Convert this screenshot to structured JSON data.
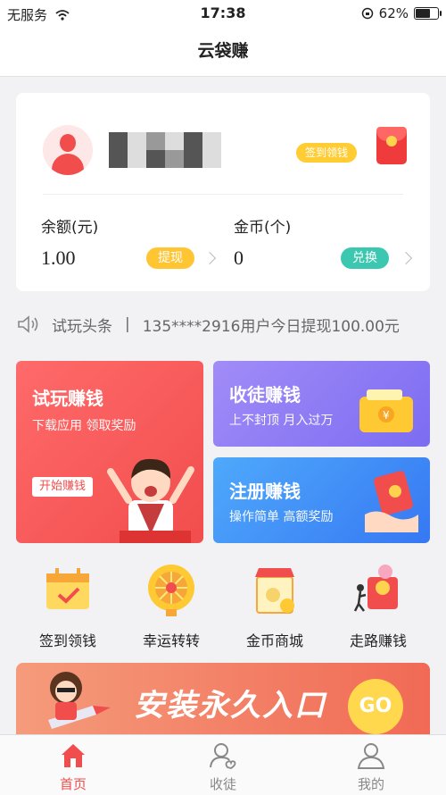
{
  "status_bar": {
    "carrier": "无服务",
    "time": "17:38",
    "battery": "62%"
  },
  "nav": {
    "title": "云袋赚"
  },
  "account": {
    "sign_label": "签到领钱",
    "balance_label": "余额(元)",
    "balance_value": "1.00",
    "withdraw_label": "提现",
    "coins_label": "金币(个)",
    "coins_value": "0",
    "exchange_label": "兑换"
  },
  "ticker": {
    "title": "试玩头条",
    "separator": "|",
    "message": "135****2916用户今日提现100.00元"
  },
  "tiles": {
    "trial": {
      "title": "试玩赚钱",
      "subtitle": "下载应用 领取奖励",
      "button": "开始赚钱"
    },
    "recruit": {
      "title": "收徒赚钱",
      "subtitle": "上不封顶 月入过万"
    },
    "register": {
      "title": "注册赚钱",
      "subtitle": "操作简单 高额奖励"
    }
  },
  "shortcuts": [
    {
      "label": "签到领钱",
      "icon": "calendar-icon"
    },
    {
      "label": "幸运转转",
      "icon": "lucky-wheel-icon"
    },
    {
      "label": "金币商城",
      "icon": "shop-icon"
    },
    {
      "label": "走路赚钱",
      "icon": "walk-money-icon"
    }
  ],
  "banner": {
    "text": "安装永久入口",
    "go": "GO"
  },
  "tabbar": [
    {
      "label": "首页",
      "icon": "home-icon",
      "active": true
    },
    {
      "label": "收徒",
      "icon": "recruit-icon",
      "active": false
    },
    {
      "label": "我的",
      "icon": "profile-icon",
      "active": false
    }
  ],
  "colors": {
    "accent": "#f24d4d",
    "yellow": "#ffcc33",
    "teal": "#3cc8b0",
    "purple": "#8b7cf6",
    "blue": "#3d8ef7"
  }
}
